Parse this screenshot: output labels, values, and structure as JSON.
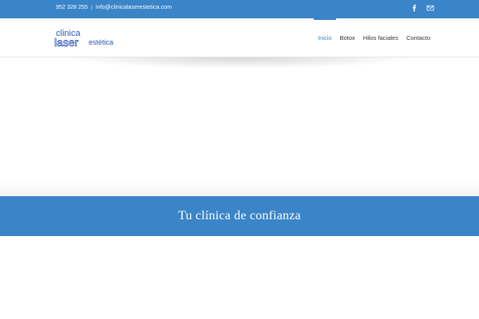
{
  "topbar": {
    "phone": "952 328 255",
    "separator": "|",
    "email": "info@clinicalaserestetica.com",
    "social": [
      "facebook-icon",
      "mail-icon"
    ]
  },
  "logo": {
    "line1": "clinica",
    "line2": "laser",
    "line3": "estética"
  },
  "nav": {
    "items": [
      {
        "label": "Inicio",
        "active": true
      },
      {
        "label": "Botox",
        "active": false
      },
      {
        "label": "Hilos faciales",
        "active": false
      },
      {
        "label": "Contacto",
        "active": false
      }
    ]
  },
  "hero": {
    "tagline": "Tu clínica de confianza"
  },
  "colors": {
    "brand": "#3a84c8",
    "text": "#333333",
    "logo": "#2a56b8"
  }
}
